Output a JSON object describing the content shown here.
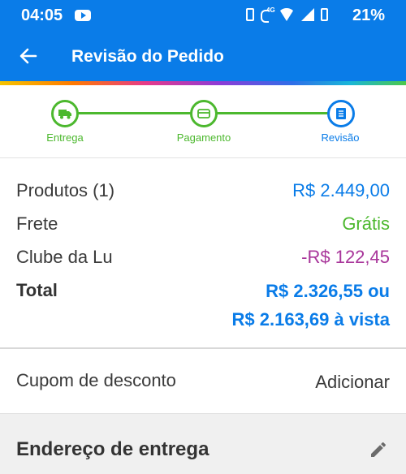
{
  "status_bar": {
    "time": "04:05",
    "battery": "21%",
    "icons": [
      "youtube-icon",
      "vibrate-icon",
      "wifi-call-4g-icon",
      "wifi-icon",
      "signal-icon",
      "battery-icon"
    ]
  },
  "app_bar": {
    "title": "Revisão do Pedido",
    "back_icon": "arrow-left-icon"
  },
  "stepper": {
    "steps": [
      {
        "label": "Entrega",
        "icon": "truck-icon",
        "state": "done"
      },
      {
        "label": "Pagamento",
        "icon": "card-icon",
        "state": "done"
      },
      {
        "label": "Revisão",
        "icon": "document-icon",
        "state": "current"
      }
    ]
  },
  "summary": {
    "products_label": "Produtos (1)",
    "products_value": "R$ 2.449,00",
    "shipping_label": "Frete",
    "shipping_value": "Grátis",
    "club_label": "Clube da Lu",
    "club_value": "-R$ 122,45",
    "total_label": "Total",
    "total_value_line1": "R$ 2.326,55 ou",
    "total_value_line2": "R$ 2.163,69 à vista"
  },
  "coupon": {
    "label": "Cupom de desconto",
    "action": "Adicionar"
  },
  "address": {
    "title": "Endereço de entrega",
    "edit_icon": "pencil-icon"
  },
  "colors": {
    "primary_blue": "#0a7ce8",
    "success_green": "#4cb82e",
    "discount_purple": "#a8359a"
  }
}
